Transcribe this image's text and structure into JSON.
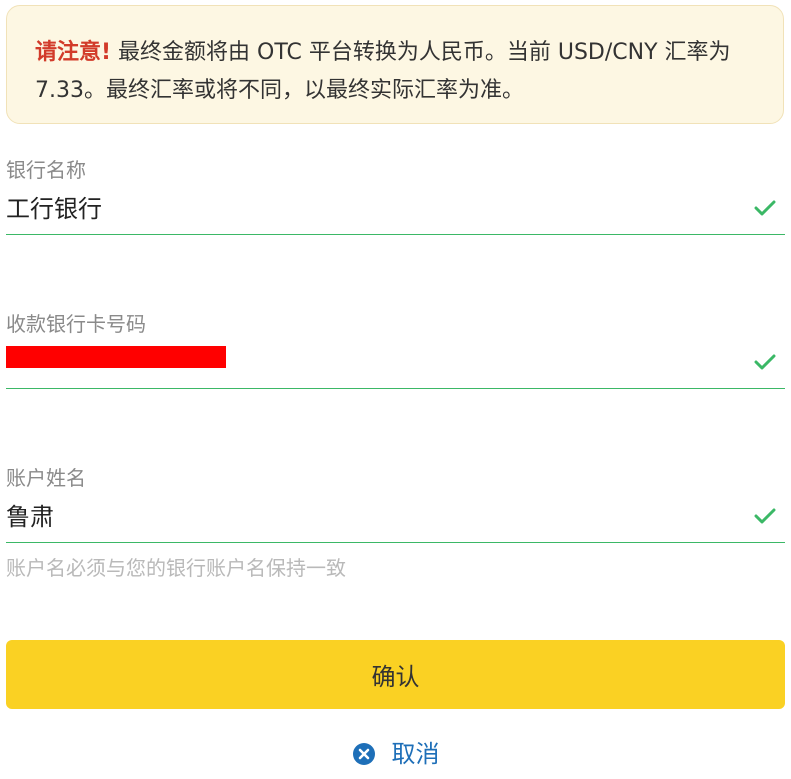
{
  "notice": {
    "warning": "请注意!",
    "text": " 最终金额将由 OTC 平台转换为人民币。当前 USD/CNY 汇率为 7.33。最终汇率或将不同，以最终实际汇率为准。"
  },
  "form": {
    "bank_name": {
      "label": "银行名称",
      "value": "工行银行"
    },
    "card_number": {
      "label": "收款银行卡号码",
      "value_redacted": true
    },
    "account_name": {
      "label": "账户姓名",
      "value": "鲁肃",
      "hint": "账户名必须与您的银行账户名保持一致"
    }
  },
  "buttons": {
    "confirm": "确认",
    "cancel": "取消"
  },
  "icons": {
    "field_valid": "check-icon",
    "cancel": "close-circle-icon"
  },
  "colors": {
    "warning": "#d23b2a",
    "valid": "#3bb866",
    "confirm_bg": "#fad123",
    "cancel_text": "#1e6fb8",
    "notice_bg": "#fdf7e3"
  }
}
